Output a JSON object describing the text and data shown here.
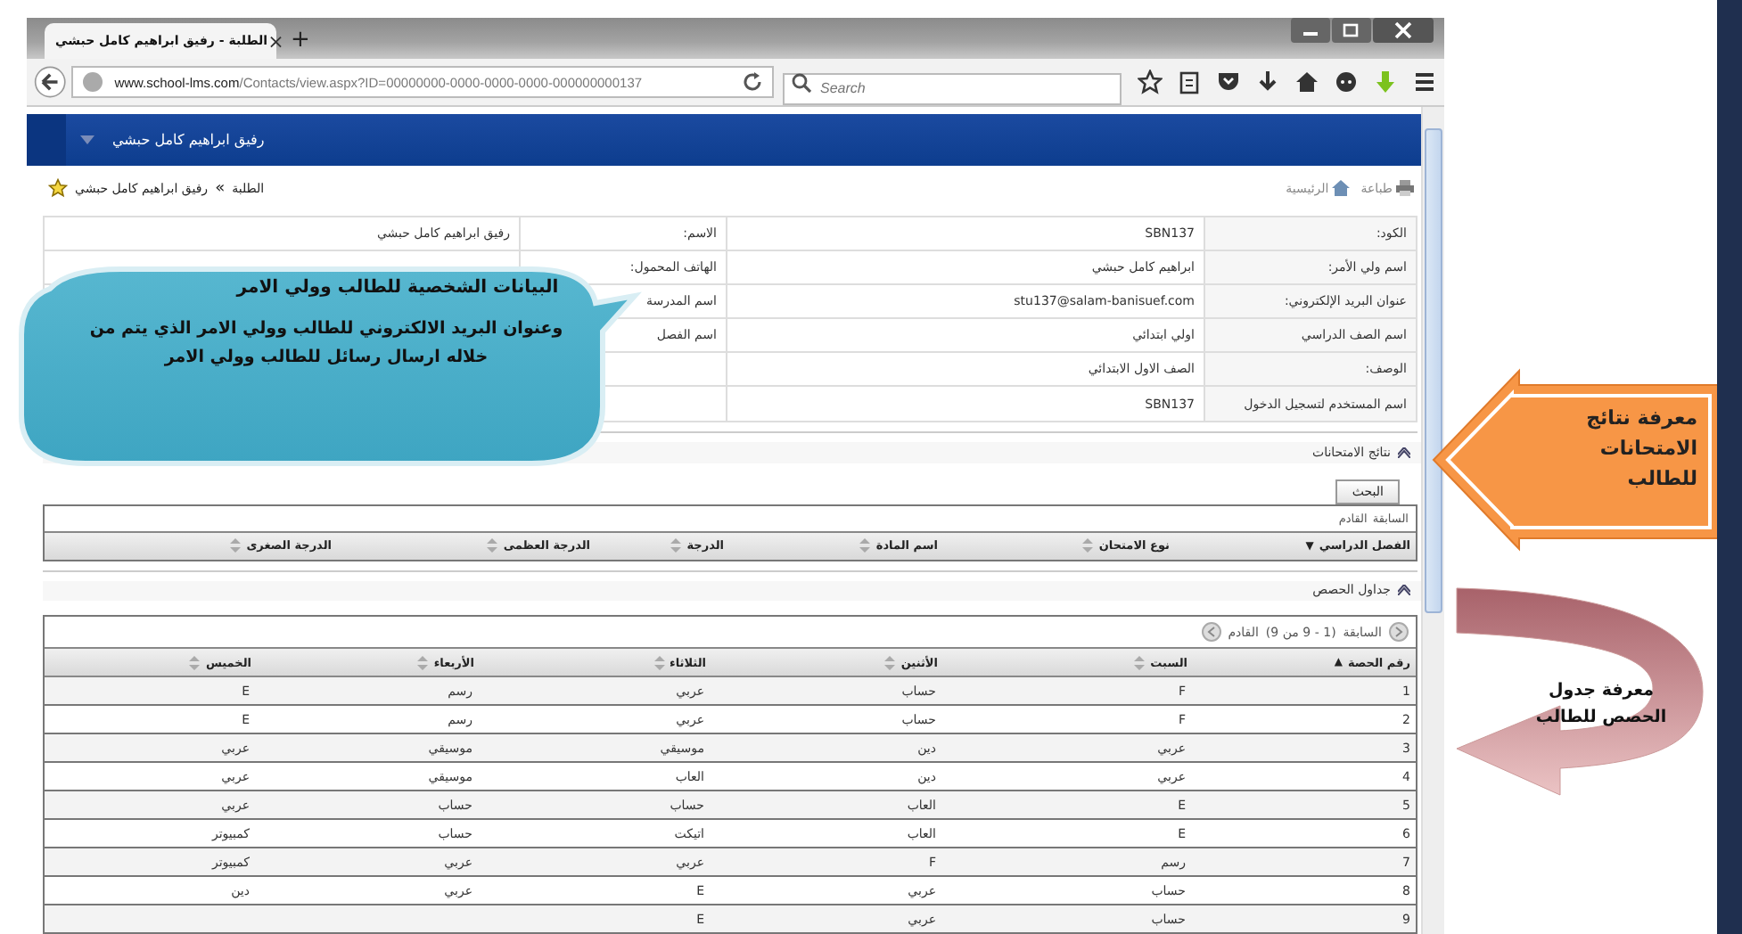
{
  "browser": {
    "tab_title": "الطلبة - رفيق ابراهيم كامل حبشي",
    "close_glyph": "×",
    "new_tab_glyph": "+",
    "url_host": "www.school-lms.com",
    "url_path": "/Contacts/view.aspx?ID=00000000-0000-0000-0000-000000000137",
    "search_placeholder": "Search"
  },
  "header": {
    "title": "رفيق ابراهيم كامل حبشي"
  },
  "toolbar": {
    "actions": [
      {
        "label": "طباعة",
        "kind": "print"
      },
      {
        "label": "الرئيسية",
        "kind": "home"
      }
    ],
    "breadcrumb_parent": "الطلبة",
    "breadcrumb_separator": "»",
    "breadcrumb_current": "رفيق ابراهيم كامل حبشي"
  },
  "profile": [
    {
      "label": "الكود:",
      "value": "SBN137",
      "label_2": "الاسم:",
      "value_2": "رفيق ابراهيم كامل حبشي"
    },
    {
      "label": "اسم ولي الأمر:",
      "value": "ابراهيم كامل حبشي",
      "label_2": "الهاتف المحمول:"
    },
    {
      "label": "عنوان البريد الإلكتروني:",
      "value": "stu137@salam-banisuef.com",
      "label_2": "اسم المدرسة"
    },
    {
      "label": "اسم الصف الدراسي",
      "value": "اولي ابتدائي",
      "label_2": "اسم الفصل"
    },
    {
      "label": "الوصف:",
      "value": "الصف الاول الابتدائي"
    },
    {
      "label": "اسم المستخدم لتسجيل الدخول",
      "value": "SBN137"
    }
  ],
  "exams": {
    "title": "نتائج الامتحانات",
    "expanded": true,
    "search_button": "البحث",
    "pager_prev": "السابقة",
    "pager_next": "القادم",
    "columns": [
      {
        "label": "الفصل الدراسي",
        "sort_arrow": "▼"
      },
      {
        "label": "نوع الامتحان",
        "sortable": true
      },
      {
        "label": "اسم المادة",
        "sortable": true
      },
      {
        "label": "الدرجة",
        "sortable": true
      },
      {
        "label": "الدرجة العظمى",
        "sortable": true
      },
      {
        "label": "الدرجة الصغرى",
        "sortable": true
      }
    ]
  },
  "schedule": {
    "title": "جداول الحصص",
    "expanded": true,
    "pager_prev": "السابقة",
    "pager_range": "(1 - 9 من 9)",
    "pager_next": "القادم",
    "columns": [
      {
        "label": "رقم الحصة",
        "sort_arrow": "▲"
      },
      {
        "label": "السبت",
        "sortable": true
      },
      {
        "label": "الأثنين",
        "sortable": true
      },
      {
        "label": "الثلاثاء",
        "sortable": true
      },
      {
        "label": "الأربعاء",
        "sortable": true
      },
      {
        "label": "الخميس",
        "sortable": true
      }
    ],
    "rows": [
      [
        "1",
        "F",
        "حساب",
        "عربي",
        "رسم",
        "E"
      ],
      [
        "2",
        "F",
        "حساب",
        "عربي",
        "رسم",
        "E"
      ],
      [
        "3",
        "عربي",
        "دين",
        "موسيقي",
        "موسيقي",
        "عربي"
      ],
      [
        "4",
        "عربي",
        "دين",
        "العاب",
        "موسيقي",
        "عربي"
      ],
      [
        "5",
        "E",
        "العاب",
        "حساب",
        "حساب",
        "عربي"
      ],
      [
        "6",
        "E",
        "العاب",
        "اتيكت",
        "حساب",
        "كمبيوتر"
      ],
      [
        "7",
        "رسم",
        "F",
        "عربي",
        "عربي",
        "كمبيوتر"
      ],
      [
        "8",
        "حساب",
        "عربي",
        "E",
        "عربي",
        "دين"
      ],
      [
        "9",
        "حساب",
        "عربي",
        "E",
        null,
        null
      ]
    ]
  },
  "annotations": {
    "personal_title": "البيانات الشخصية للطالب وولي الامر",
    "personal_text": "وعنوان البريد الالكتروني للطالب وولي الامر الذي يتم من خلاله ارسال رسائل للطالب وولي الامر",
    "exams_note": "معرفة نتائج الامتحانات للطالب",
    "schedule_note": "معرفة جدول الحصص للطالب"
  }
}
